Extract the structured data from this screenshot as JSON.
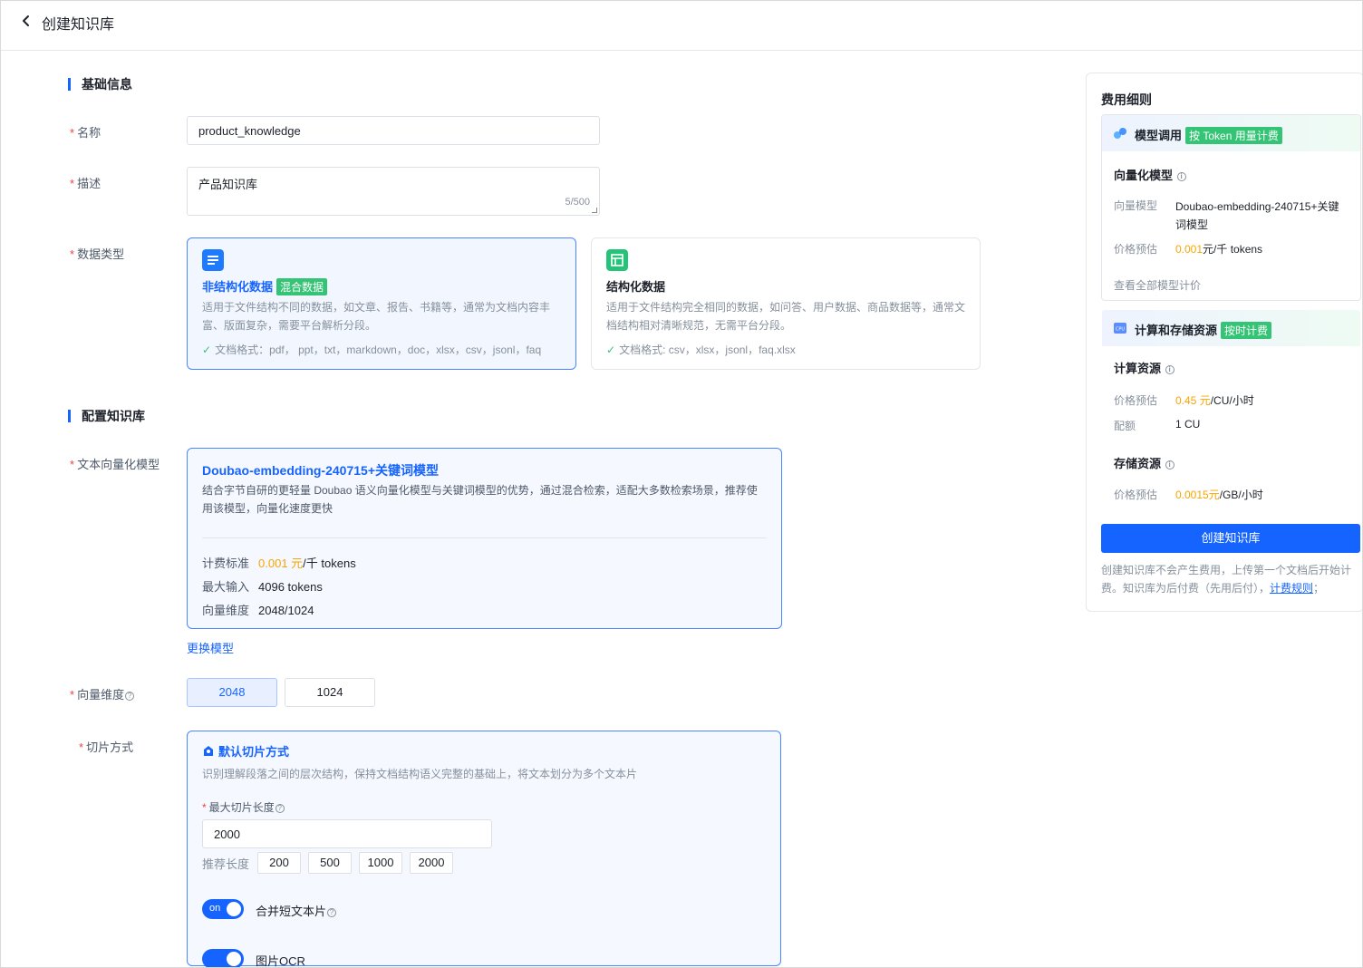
{
  "header": {
    "title": "创建知识库"
  },
  "basic": {
    "section_title": "基础信息",
    "name_label": "名称",
    "name_value": "product_knowledge",
    "desc_label": "描述",
    "desc_value": "产品知识库",
    "desc_count": "5/500",
    "type_label": "数据类型",
    "types": [
      {
        "title": "非结构化数据",
        "tag": "混合数据",
        "desc": "适用于文件结构不同的数据，如文章、报告、书籍等，通常为文档内容丰富、版面复杂，需要平台解析分段。",
        "formats": "文档格式：pdf，  ppt，txt，markdown，doc，xlsx，csv，jsonl，faq",
        "selected": true
      },
      {
        "title": "结构化数据",
        "tag": "",
        "desc": "适用于文件结构完全相同的数据，如问答、用户数据、商品数据等，通常文档结构相对清晰规范，无需平台分段。",
        "formats": "文档格式: csv，xlsx，jsonl，faq.xlsx",
        "selected": false
      }
    ]
  },
  "config": {
    "section_title": "配置知识库",
    "model_label": "文本向量化模型",
    "model_name": "Doubao-embedding-240715+关键词模型",
    "model_desc": "结合字节自研的更轻量 Doubao 语义向量化模型与关键词模型的优势，通过混合检索，适配大多数检索场景，推荐使用该模型，向量化速度更快",
    "price_label": "计费标准",
    "price_num": "0.001 元",
    "price_unit": "/千 tokens",
    "max_input_label": "最大输入",
    "max_input_value": "4096 tokens",
    "dim_label": "向量维度",
    "dim_value": "2048/1024",
    "change_model": "更换模型",
    "dimension_field_label": "向量维度",
    "dimension_options": [
      "2048",
      "1024"
    ],
    "chunk_label": "切片方式",
    "chunk_title": "默认切片方式",
    "chunk_desc": "识别理解段落之间的层次结构，保持文档结构语义完整的基础上，将文本划分为多个文本片",
    "max_len_label": "最大切片长度",
    "max_len_value": "2000",
    "recommend_label": "推荐长度",
    "recommend_values": [
      "200",
      "500",
      "1000",
      "2000"
    ],
    "merge_label": "合并短文本片",
    "toggle_on": "on",
    "ocr_label": "图片OCR"
  },
  "sidebar": {
    "title": "费用细则",
    "model_call": "模型调用",
    "model_call_tag": "按 Token 用量计费",
    "vector_model_title": "向量化模型",
    "vector_model_key": "向量模型",
    "vector_model_value": "Doubao-embedding-240715+关键词模型",
    "price_key": "价格预估",
    "vector_price_num": "0.001",
    "vector_price_unit": "元/千 tokens",
    "view_all": "查看全部模型计价",
    "compute_storage": "计算和存储资源",
    "compute_storage_tag": "按时计费",
    "compute_title": "计算资源",
    "compute_price_num": "0.45 元",
    "compute_price_unit": "/CU/小时",
    "quota_key": "配额",
    "quota_value": "1 CU",
    "storage_title": "存储资源",
    "storage_price_num": "0.0015元",
    "storage_price_unit": "/GB/小时",
    "create_button": "创建知识库",
    "note_text": "创建知识库不会产生费用，上传第一个文档后开始计费。知识库为后付费（先用后付），",
    "note_link": "计费规则",
    "note_end": "；"
  },
  "colors": {
    "accent": "#1664ff",
    "price": "#f7a500",
    "success": "#35c475"
  }
}
